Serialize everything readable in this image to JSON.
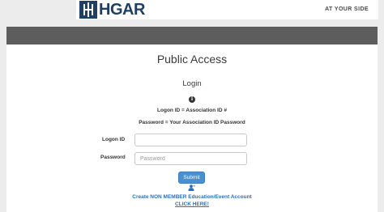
{
  "header": {
    "logo_text": "HGAR",
    "tagline": "AT YOUR SIDE"
  },
  "main": {
    "title": "Public Access",
    "subtitle": "Login",
    "hint_logon": "Logon ID = Association ID #",
    "hint_password": "Password = Your Association ID Password",
    "logon_label": "Logon ID",
    "logon_value": "",
    "password_label": "Password",
    "password_placeholder": "Password",
    "submit_label": "Submit",
    "create_account_text": "Create NON MEMBER Education/Event Account",
    "click_here_text": "CLICK HERE!"
  },
  "colors": {
    "brand_navy": "#1f3f63",
    "header_bar": "#5d5d5d",
    "button_blue": "#4a8fd0",
    "link_blue": "#2a6fbf"
  },
  "icons": [
    "hgar-logo-mark",
    "info-icon",
    "user-icon"
  ]
}
